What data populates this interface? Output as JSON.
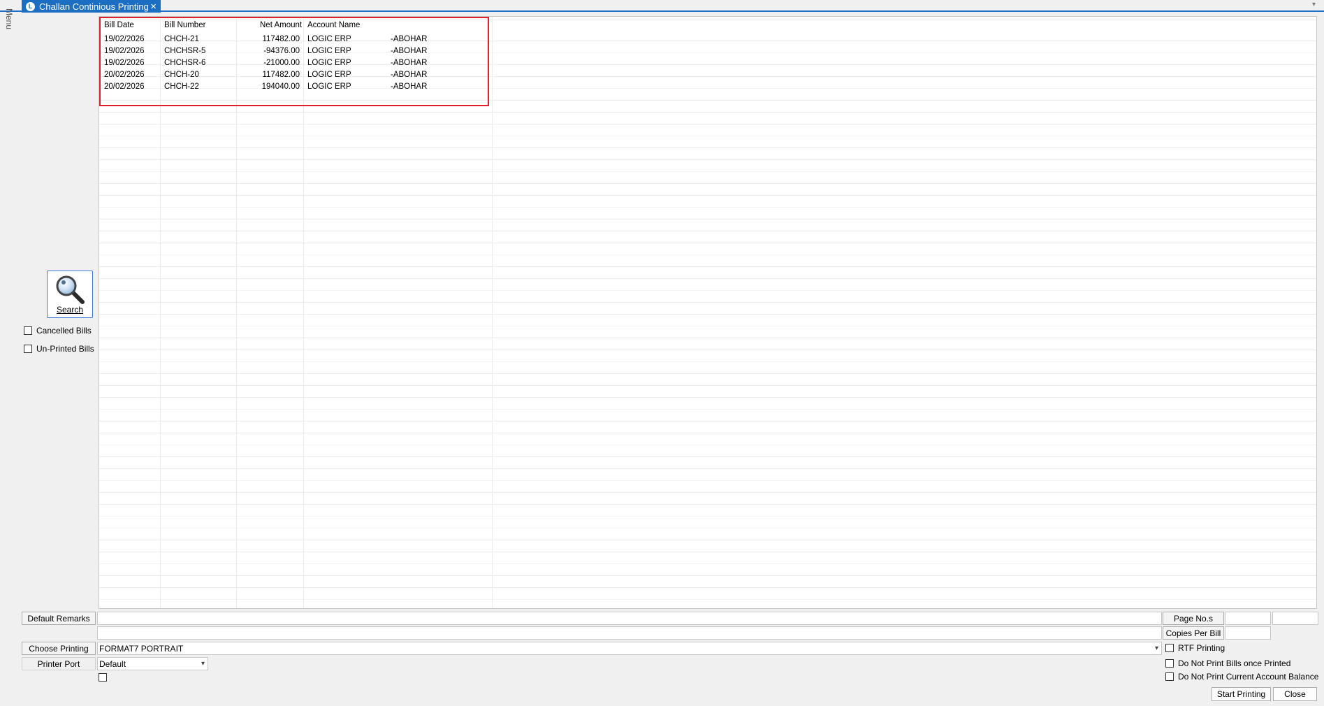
{
  "window": {
    "tab_title": "Challan Continious Printing",
    "close_glyph": "×",
    "menu_label": "Menu"
  },
  "grid": {
    "columns": [
      "Bill Date",
      "Bill Number",
      "Net Amount",
      "Account Name"
    ],
    "rows": [
      {
        "date": "19/02/2026",
        "number": "CHCH-21",
        "amount": "117482.00",
        "account": "LOGIC ERP",
        "place": "-ABOHAR"
      },
      {
        "date": "19/02/2026",
        "number": "CHCHSR-5",
        "amount": "-94376.00",
        "account": "LOGIC ERP",
        "place": "-ABOHAR"
      },
      {
        "date": "19/02/2026",
        "number": "CHCHSR-6",
        "amount": "-21000.00",
        "account": "LOGIC ERP",
        "place": "-ABOHAR"
      },
      {
        "date": "20/02/2026",
        "number": "CHCH-20",
        "amount": "117482.00",
        "account": "LOGIC ERP",
        "place": "-ABOHAR"
      },
      {
        "date": "20/02/2026",
        "number": "CHCH-22",
        "amount": "194040.00",
        "account": "LOGIC ERP",
        "place": "-ABOHAR"
      }
    ]
  },
  "left": {
    "search_label": "Search",
    "cancelled_bills": "Cancelled Bills",
    "unprinted_bills": "Un-Printed Bills"
  },
  "bottom": {
    "default_remarks": "Default Remarks",
    "choose_printing": "Choose Printing",
    "printing_format": "FORMAT7 PORTRAIT",
    "printer_port": "Printer Port",
    "printer_port_value": "Default",
    "page_nos": "Page No.s",
    "copies_per_bill": "Copies Per Bill",
    "rtf_printing": "RTF Printing",
    "no_reprint": "Do Not Print Bills once Printed",
    "no_balance": "Do Not Print Current Account Balance",
    "start_printing": "Start Printing",
    "close": "Close"
  },
  "colors": {
    "accent": "#1b6ec2",
    "highlight": "#e0202c"
  }
}
